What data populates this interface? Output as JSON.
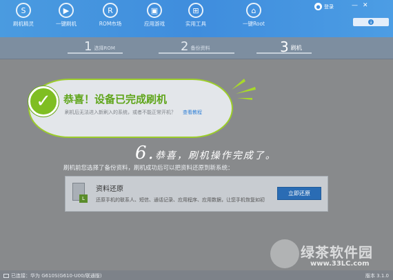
{
  "nav": {
    "items": [
      {
        "label": "刷机精灵",
        "icon": "S"
      },
      {
        "label": "一键刷机",
        "icon": "▶"
      },
      {
        "label": "ROM市场",
        "icon": "R"
      },
      {
        "label": "应用游戏",
        "icon": "▣"
      },
      {
        "label": "实用工具",
        "icon": "⊞"
      },
      {
        "label": "一键Root",
        "icon": "⌂"
      }
    ],
    "login": "登录",
    "window_controls": [
      "—",
      "✕"
    ],
    "download_icon": "↓"
  },
  "steps": [
    {
      "num": "1",
      "label": "选择ROM"
    },
    {
      "num": "2",
      "label": "备份资料"
    },
    {
      "num": "3",
      "label": "刷机"
    }
  ],
  "result": {
    "title": "恭喜！设备已完成刷机",
    "desc": "刷机后无法进入新刷入的系统，或者不能正常开机？",
    "link": "查看教程"
  },
  "annotation": {
    "number": "6.",
    "text": "恭喜，刷机操作完成了。"
  },
  "backup": {
    "intro": "刷机前您选择了备份资料，刷机成功后可以把资料还原到新系统：",
    "restore_title": "资料还原",
    "restore_desc": "还原手机的联系人、短信、通话记录、应用程序、应用数据，让您手机恢复如初",
    "restore_button": "立即还原"
  },
  "watermark": {
    "name": "绿茶软件园",
    "url": "www.33LC.com"
  },
  "status": {
    "connection": "已连接：华为 G610S(G610-U00/联通版)",
    "version": "版本 3.1.0"
  },
  "colors": {
    "accent_blue": "#3f8ddd",
    "success_green": "#7fbe22",
    "button_blue": "#2a6cb4"
  }
}
